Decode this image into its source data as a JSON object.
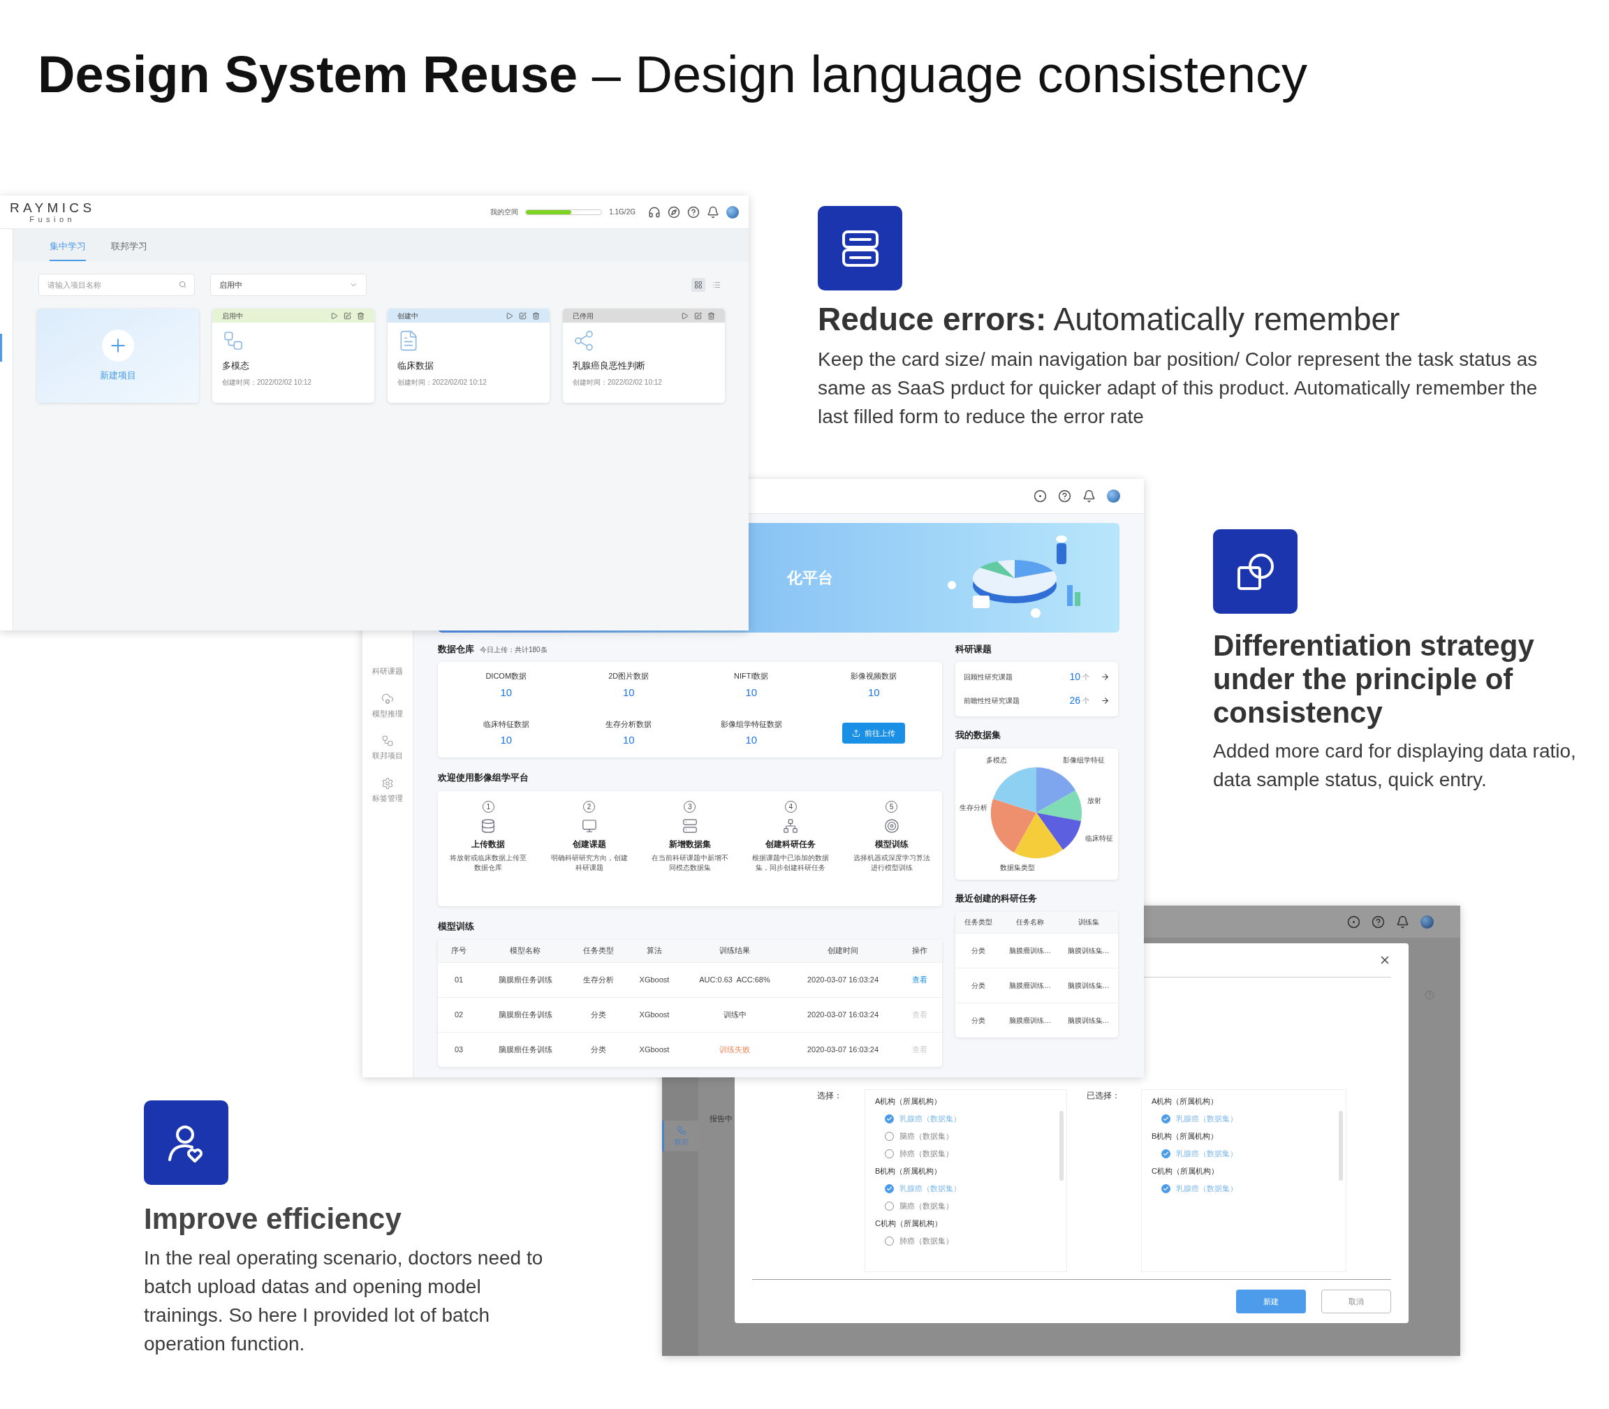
{
  "title": "**Design System Reuse** – Design language consistency",
  "features": [
    {
      "kind": "errors",
      "heading": "**Reduce errors:** Automatically remember",
      "text": "Keep the card size/ main navigation bar position/ Color represent the task status as same as SaaS prduct for quicker adapt of this product. Automatically remember the last filled form to reduce the error rate"
    },
    {
      "kind": "differentiation",
      "heading": "Differentiation strategy under the principle of consistency",
      "text": "Added more card for displaying data ratio, data sample status, quick entry."
    },
    {
      "kind": "efficiency",
      "heading": "Improve efficiency",
      "text": "In the real operating scenario, doctors need to batch upload datas and opening model trainings. So here I provided lot of batch operation function."
    }
  ],
  "screen1": {
    "logo": "RAYMICS",
    "logo_sub": "Fusion",
    "storage": {
      "label": "我的空间",
      "level": 0.6,
      "reading": "1.1G/2G"
    },
    "tabs": [
      {
        "label": "集中学习",
        "selected": true
      },
      {
        "label": "联邦学习",
        "selected": false
      }
    ],
    "search": {
      "placeholder": "请输入项目名称"
    },
    "filter": {
      "value": "启用中"
    },
    "view_modes": [
      {
        "kind": "grid",
        "selected": true
      },
      {
        "kind": "list",
        "selected": false
      }
    ],
    "new_project": {
      "label": "新建项目"
    },
    "projects": [
      {
        "status": "启用中",
        "color": "#e6f4d5",
        "kind": "flow",
        "name": "多模态",
        "created": "创建时间：2022/02/02 10:12"
      },
      {
        "status": "创建中",
        "color": "#d5e9f8",
        "kind": "document",
        "name": "临床数据",
        "created": "创建时间：2022/02/02 10:12"
      },
      {
        "status": "已停用",
        "color": "#dcdcdc",
        "kind": "graph",
        "name": "乳腺癌良恶性判断",
        "created": "创建时间：2022/02/02 10:12"
      }
    ]
  },
  "screen2": {
    "sidebar": [
      {
        "kind": "none",
        "label": "科研课题"
      },
      {
        "kind": "cloud",
        "label": "模型推理"
      },
      {
        "kind": "flow",
        "label": "联邦项目"
      },
      {
        "kind": "gear",
        "label": "标签管理"
      }
    ],
    "banner": {
      "title": "化平台"
    },
    "warehouse": {
      "title": "数据仓库",
      "note": "今日上传：共计180条",
      "stats": [
        {
          "label": "DICOM数据",
          "value": "10"
        },
        {
          "label": "2D图片数据",
          "value": "10"
        },
        {
          "label": "NIFTI数据",
          "value": "10"
        },
        {
          "label": "影像视频数据",
          "value": "10"
        },
        {
          "label": "临床特征数据",
          "value": "10"
        },
        {
          "label": "生存分析数据",
          "value": "10"
        },
        {
          "label": "影像组学特征数据",
          "value": "10"
        }
      ],
      "upload_button": "前往上传"
    },
    "steps_title": "欢迎使用影像组学平台",
    "steps": [
      {
        "number": "1",
        "kind": "database",
        "title": "上传数据",
        "text": "将放射或临床数据上传至数据仓库"
      },
      {
        "number": "2",
        "kind": "monitor",
        "title": "创建课题",
        "text": "明确科研研究方向，创建科研课题"
      },
      {
        "number": "3",
        "kind": "dataset",
        "title": "新增数据集",
        "text": "在当前科研课题中新增不同模态数据集"
      },
      {
        "number": "4",
        "kind": "network",
        "title": "创建科研任务",
        "text": "根据课题中已添加的数据集，同步创建科研任务"
      },
      {
        "number": "5",
        "kind": "target",
        "title": "模型训练",
        "text": "选择机器或深度学习算法进行模型训练"
      }
    ],
    "training": {
      "title": "模型训练",
      "columns": [
        "序号",
        "模型名称",
        "任务类型",
        "算法",
        "训练结果",
        "创建时间",
        "操作"
      ],
      "rows": [
        {
          "cells": [
            "01",
            "脑膜瘤任务训练",
            "生存分析",
            "XGboost"
          ],
          "result": "AUC:0.63  ACC:68%",
          "failed": false,
          "created": "2020-03-07 16:03:24",
          "action": "查看",
          "action_enabled": true
        },
        {
          "cells": [
            "02",
            "脑膜瘤任务训练",
            "分类",
            "XGboost"
          ],
          "result": "训练中",
          "failed": false,
          "created": "2020-03-07 16:03:24",
          "action": "查看",
          "action_enabled": false
        },
        {
          "cells": [
            "03",
            "脑膜瘤任务训练",
            "分类",
            "XGboost"
          ],
          "result": "训练失败",
          "failed": true,
          "created": "2020-03-07 16:03:24",
          "action": "查看",
          "action_enabled": false
        }
      ]
    },
    "topics": {
      "title": "科研课题",
      "items": [
        {
          "label": "回顾性研究课题",
          "count": "10",
          "unit": "个"
        },
        {
          "label": "前瞻性性研究课题",
          "count": "26",
          "unit": "个"
        }
      ]
    },
    "datasets": {
      "title": "我的数据集",
      "labels": [
        "多模态",
        "影像组学特征",
        "放射",
        "生存分析",
        "临床特征",
        "数据集类型"
      ]
    },
    "recent": {
      "title": "最近创建的科研任务",
      "columns": [
        "任务类型",
        "任务名称",
        "训练集"
      ],
      "rows": [
        [
          "分类",
          "脑膜瘤训练…",
          "脑膜训练集…"
        ],
        [
          "分类",
          "脑膜瘤训练…",
          "脑膜训练集…"
        ],
        [
          "分类",
          "脑膜瘤训练…",
          "脑膜训练集…"
        ]
      ]
    }
  },
  "screen3": {
    "sidebar_text": "报告中",
    "nav_item": {
      "label": "联邦",
      "selected": true
    },
    "dialog": {
      "select_label": "选择：",
      "groups": [
        {
          "name": "A机构（所属机构）",
          "items": [
            {
              "label": "乳腺癌（数据集）",
              "checked": true
            },
            {
              "label": "脑癌（数据集）",
              "checked": false
            },
            {
              "label": "肺癌（数据集）",
              "checked": false
            }
          ]
        },
        {
          "name": "B机构（所属机构）",
          "items": [
            {
              "label": "乳腺癌（数据集）",
              "checked": true
            },
            {
              "label": "脑癌（数据集）",
              "checked": false
            }
          ]
        },
        {
          "name": "C机构（所属机构）",
          "items": [
            {
              "label": "肺癌（数据集）",
              "checked": false
            }
          ]
        }
      ],
      "selected_label": "已选择：",
      "selected_groups": [
        {
          "name": "A机构（所属机构）",
          "items": [
            {
              "label": "乳腺癌（数据集）",
              "checked": true
            }
          ]
        },
        {
          "name": "B机构（所属机构）",
          "items": [
            {
              "label": "乳腺癌（数据集）",
              "checked": true
            }
          ]
        },
        {
          "name": "C机构（所属机构）",
          "items": [
            {
              "label": "乳腺癌（数据集）",
              "checked": true
            }
          ]
        }
      ],
      "buttons": [
        {
          "label": "新建",
          "kind": "primary"
        },
        {
          "label": "取消",
          "kind": "secondary"
        }
      ]
    }
  }
}
